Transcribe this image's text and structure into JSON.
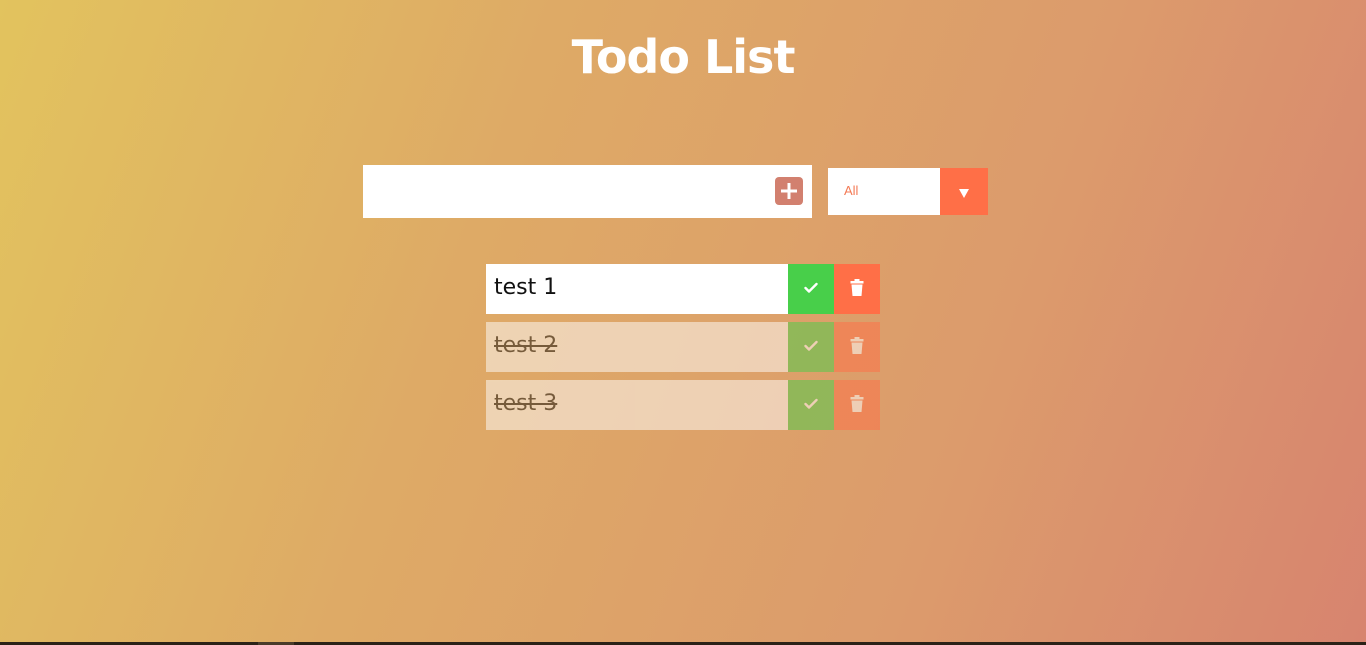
{
  "header": {
    "title": "Todo List"
  },
  "form": {
    "input_value": "",
    "input_placeholder": "",
    "add_icon": "plus-square-icon",
    "filter": {
      "selected": "All",
      "arrow_icon": "caret-down-icon"
    }
  },
  "todos": [
    {
      "text": "test 1",
      "completed": false
    },
    {
      "text": "test 2",
      "completed": true
    },
    {
      "text": "test 3",
      "completed": true
    }
  ],
  "colors": {
    "accent": "#ff6f47",
    "check": "#48cf4a",
    "add_button": "#d2806f",
    "title": "#ffffff"
  }
}
